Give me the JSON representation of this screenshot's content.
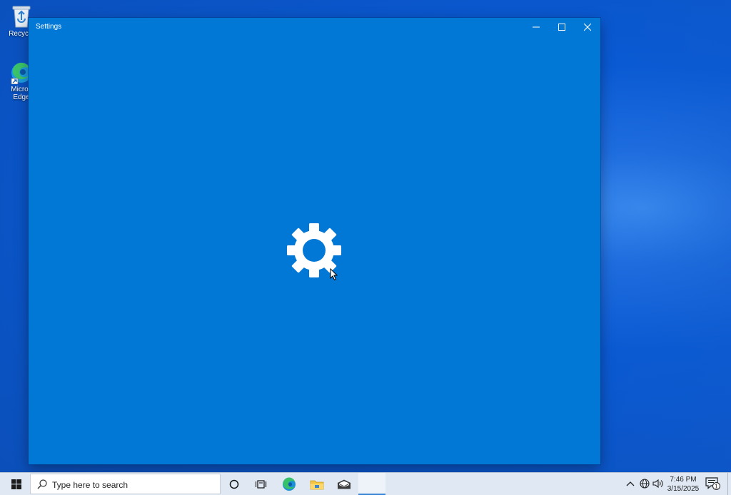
{
  "desktop": {
    "icons": [
      {
        "label": "Recycle",
        "icon": "recycle-bin-icon"
      },
      {
        "label_line1": "Micros",
        "label_line2": "Edge",
        "icon": "edge-icon"
      }
    ]
  },
  "window": {
    "title": "Settings",
    "accent": "#0278d6",
    "splash_icon": "gear-icon"
  },
  "taskbar": {
    "search_placeholder": "Type here to search",
    "pinned": [
      "cortana-icon",
      "task-view-icon",
      "edge-icon",
      "file-explorer-icon",
      "mail-icon",
      "settings-app"
    ],
    "clock_time": "7:46 PM",
    "clock_date": "3/15/2025",
    "notification_count": "1"
  }
}
